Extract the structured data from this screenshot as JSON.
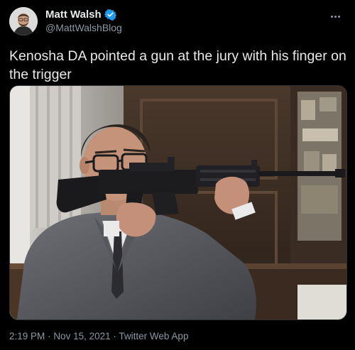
{
  "author": {
    "display_name": "Matt Walsh",
    "handle": "@MattWalshBlog",
    "verified": true
  },
  "tweet": {
    "text": "Kenosha DA pointed a gun at the jury with his finger on the trigger"
  },
  "meta": {
    "time": "2:19 PM",
    "separator": "·",
    "date": "Nov 15, 2021",
    "source": "Twitter Web App"
  },
  "colors": {
    "background": "#000000",
    "text": "#e7e9ea",
    "secondary": "#8b98a5",
    "verified_badge": "#1d9bf0"
  },
  "icons": [
    "verified-badge-icon",
    "more-options-icon"
  ]
}
